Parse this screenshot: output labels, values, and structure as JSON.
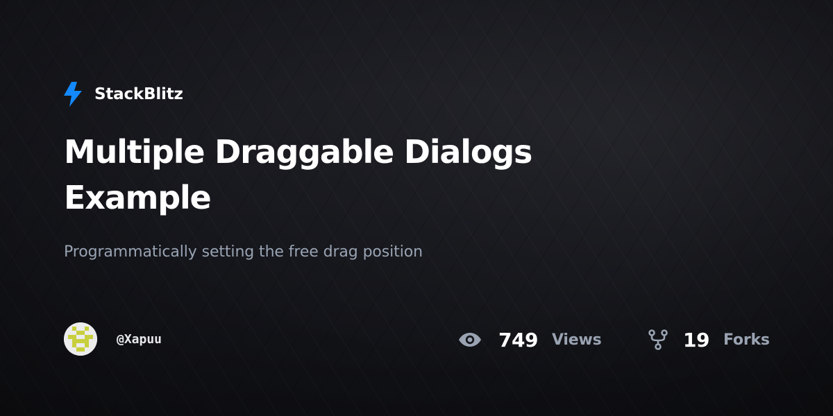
{
  "brand": {
    "name": "StackBlitz",
    "icon": "lightning-bolt-icon",
    "icon_color": "#1389fd"
  },
  "project": {
    "title_line1": "Multiple Draggable Dialogs",
    "title_line2": "Example",
    "description": "Programmatically setting the free drag position"
  },
  "author": {
    "username": "@Xapuu",
    "avatar": "identicon-avatar",
    "avatar_color": "#c8cf3c"
  },
  "stats": {
    "views": {
      "icon": "eye-icon",
      "value": "749",
      "label": "Views"
    },
    "forks": {
      "icon": "fork-icon",
      "value": "19",
      "label": "Forks"
    }
  },
  "colors": {
    "background": "#17181d",
    "title": "#ffffff",
    "subtitle": "#99a3b3",
    "stat_label": "#9aa3b2"
  }
}
